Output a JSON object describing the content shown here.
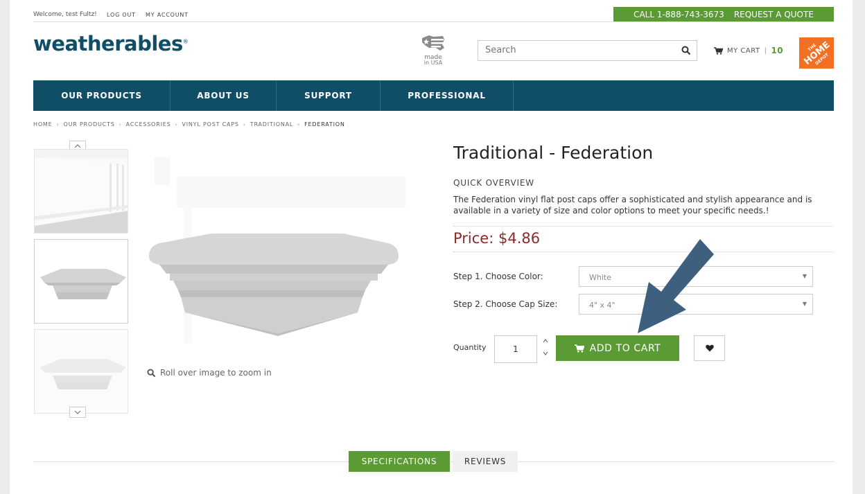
{
  "topbar": {
    "welcome": "Welcome, test Fultz!",
    "logout": "LOG OUT",
    "my_account": "MY ACCOUNT",
    "call": "CALL 1-888-743-3673",
    "quote": "REQUEST A QUOTE"
  },
  "header": {
    "logo": "weatherables",
    "logo_mark": "®",
    "made_in_usa_1": "made",
    "made_in_usa_2": "in USA",
    "search_placeholder": "Search",
    "cart_label": "MY CART",
    "cart_sep": "|",
    "cart_count": "10",
    "partner_logo": "THE HOME DEPOT"
  },
  "nav": {
    "items": [
      "OUR PRODUCTS",
      "ABOUT US",
      "SUPPORT",
      "PROFESSIONAL"
    ]
  },
  "breadcrumb": {
    "items": [
      "HOME",
      "OUR PRODUCTS",
      "ACCESSORIES",
      "VINYL POST CAPS",
      "TRADITIONAL",
      "FEDERATION"
    ],
    "sep": "›"
  },
  "gallery": {
    "zoom_hint": "Roll over image to zoom in"
  },
  "product": {
    "title": "Traditional - Federation",
    "quick_overview": "QUICK OVERVIEW",
    "description": "The Federation vinyl flat post caps offer a sophisticated and stylish appearance and is available in a variety of size and color options to meet your specific needs.!",
    "price": "Price: $4.86",
    "step1_label": "Step 1. Choose Color:",
    "step1_value": "White",
    "step2_label": "Step 2. Choose Cap Size:",
    "step2_value": "4\" x 4\"",
    "qty_label": "Quantity",
    "qty_value": "1",
    "add_to_cart": "ADD TO CART"
  },
  "tabs": {
    "specifications": "SPECIFICATIONS",
    "reviews": "REVIEWS"
  },
  "colors": {
    "brand_blue": "#0f4e66",
    "brand_green": "#5a9b35",
    "price_red": "#8b2a2a",
    "annotation_arrow": "#3f5f7f"
  }
}
